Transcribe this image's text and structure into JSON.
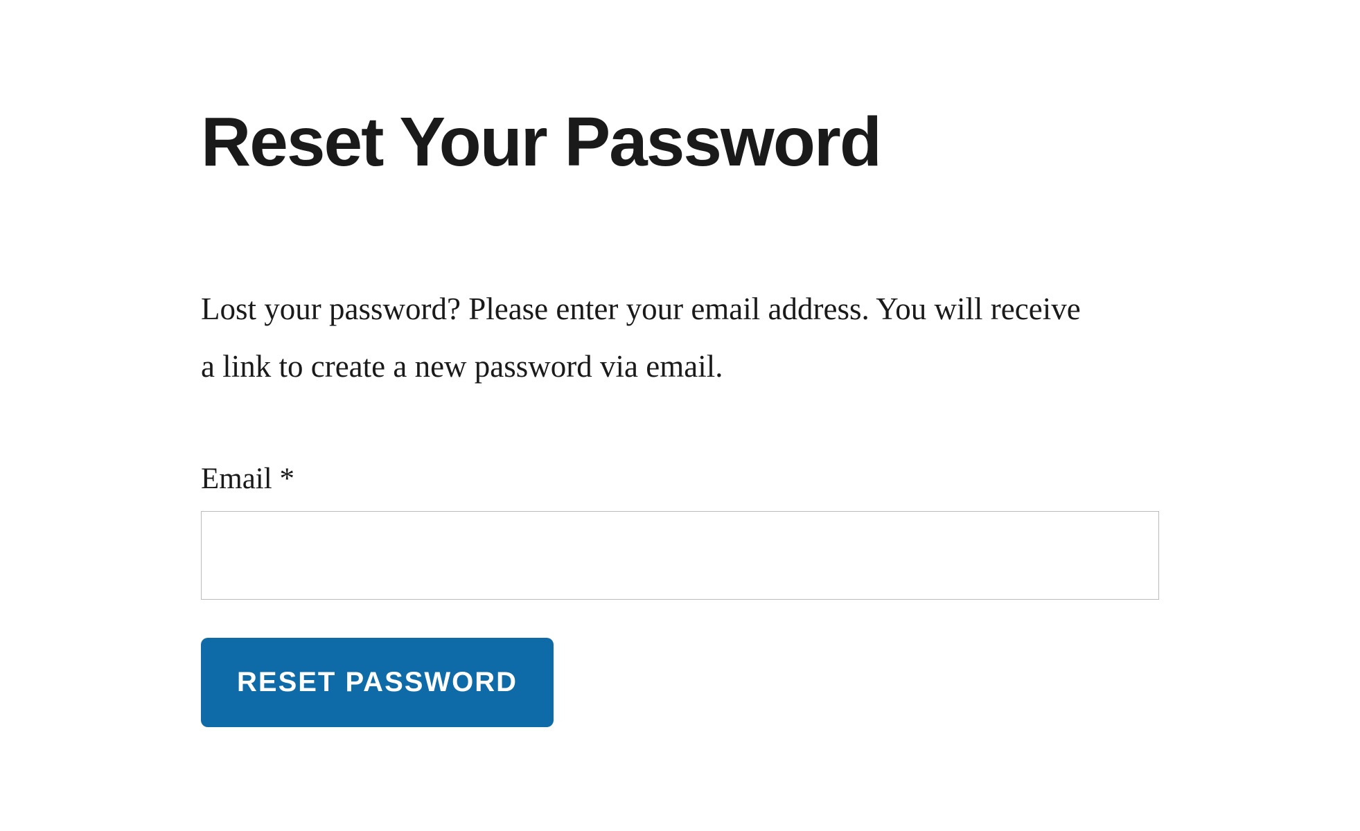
{
  "header": {
    "title": "Reset Your Password"
  },
  "content": {
    "description": "Lost your password? Please enter your email address. You will receive a link to create a new password via email."
  },
  "form": {
    "email": {
      "label": "Email ",
      "required_mark": "*",
      "value": ""
    },
    "submit_label": "RESET PASSWORD"
  }
}
